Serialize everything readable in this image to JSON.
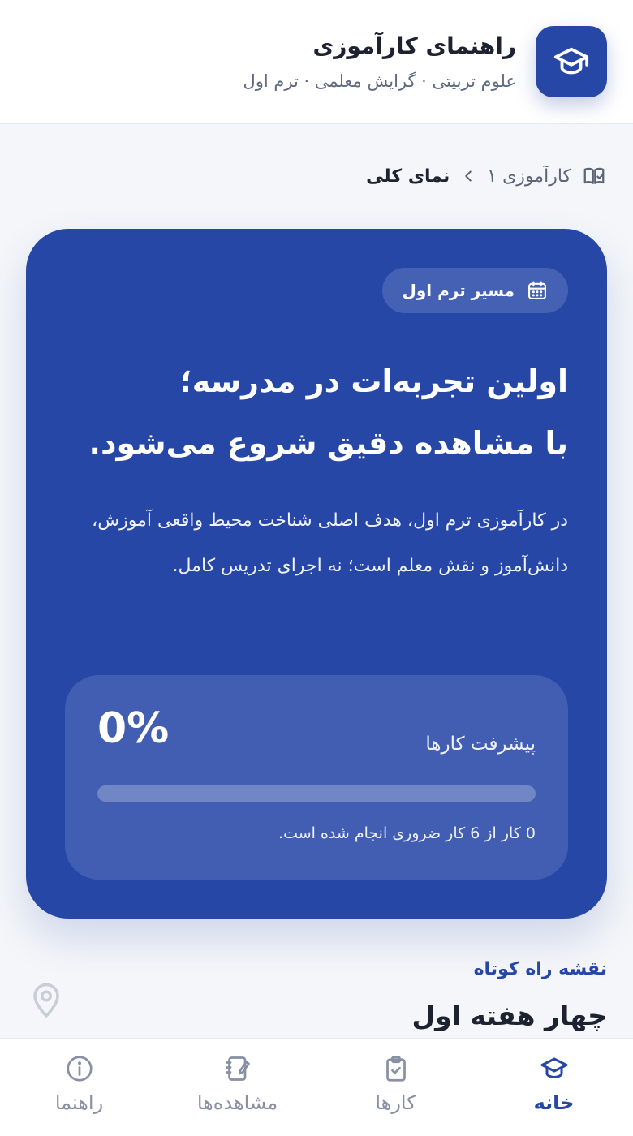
{
  "header": {
    "title": "راهنمای کارآموزی",
    "subtitle": "علوم تربیتی · گرایش معلمی · ترم اول",
    "logo_icon": "graduation-cap-icon"
  },
  "breadcrumb": {
    "icon": "book-icon",
    "parent": "کارآموزی ۱",
    "current": "نمای کلی"
  },
  "hero": {
    "chip_icon": "calendar-icon",
    "chip_label": "مسیر ترم اول",
    "title_line1": "اولین تجربه‌ات در مدرسه؛",
    "title_line2": "با مشاهده دقیق شروع می‌شود.",
    "description": "در کارآموزی ترم اول، هدف اصلی شناخت محیط واقعی آموزش، دانش‌آموز و نقش معلم است؛ نه اجرای تدریس کامل."
  },
  "progress": {
    "label": "پیشرفت کارها",
    "value_text": "0%",
    "fraction": 0,
    "note": "0 کار از 6 کار ضروری انجام شده است."
  },
  "roadmap": {
    "kicker": "نقشه راه کوتاه",
    "title": "چهار هفته اول",
    "icon": "map-pin-icon"
  },
  "nav": {
    "items": [
      {
        "label": "خانه",
        "icon": "graduation-cap-icon",
        "active": true
      },
      {
        "label": "کارها",
        "icon": "clipboard-check-icon",
        "active": false
      },
      {
        "label": "مشاهده‌ها",
        "icon": "notebook-edit-icon",
        "active": false
      },
      {
        "label": "راهنما",
        "icon": "info-icon",
        "active": false
      }
    ]
  },
  "colors": {
    "primary": "#2747a7",
    "background": "#f4f6f9",
    "nav_inactive": "#8791a3"
  }
}
